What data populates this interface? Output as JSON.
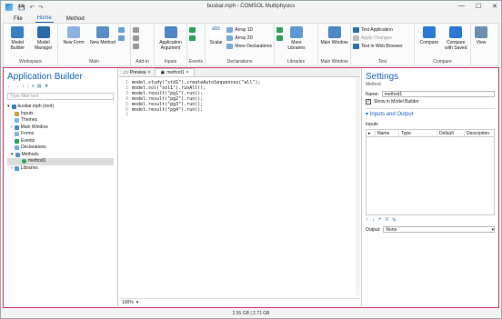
{
  "window": {
    "title": "busbar.mph - COMSOL Multiphysics",
    "minimize": "—",
    "maximize": "☐",
    "close": "✕"
  },
  "quick_access": [
    "▾",
    "↶",
    "▾",
    "↷",
    "▾"
  ],
  "menu": [
    {
      "label": "File"
    },
    {
      "label": "Home"
    },
    {
      "label": "Method"
    }
  ],
  "ribbon": {
    "workspace": {
      "label": "Workspace",
      "model_builder": "Model Builder",
      "model_manager": "Model Manager"
    },
    "main": {
      "label": "Main",
      "new_form": "New Form",
      "new_method": "New Method"
    },
    "addin": {
      "label": "Add-in"
    },
    "inputs": {
      "label": "Inputs",
      "app_argument": "Application Argument"
    },
    "events": {
      "label": "Events"
    },
    "declarations": {
      "label": "Declarations",
      "scalar": "Scalar",
      "array1d": "Array 1D",
      "array2d": "Array 2D",
      "more_decl": "More Declarations"
    },
    "libraries": {
      "label": "Libraries",
      "more_libraries": "More Libraries"
    },
    "main_window": {
      "label": "Main Window",
      "main_window": "Main Window"
    },
    "test": {
      "label": "Test",
      "test_app": "Test Application",
      "apply_changes": "Apply Changes",
      "test_browser": "Test in Web Browser"
    },
    "compare": {
      "label": "Compare",
      "compare": "Compare",
      "compare_saved": "Compare with Saved"
    },
    "layout": {
      "view": "View"
    }
  },
  "app_builder": {
    "title": "Application Builder",
    "filter_placeholder": "Type filter text",
    "tree": [
      {
        "label": "busbar.mph (root)",
        "level": 0
      },
      {
        "label": "Inputs",
        "level": 1
      },
      {
        "label": "Themes",
        "level": 1
      },
      {
        "label": "Main Window",
        "level": 1
      },
      {
        "label": "Forms",
        "level": 1
      },
      {
        "label": "Events",
        "level": 1
      },
      {
        "label": "Declarations",
        "level": 1
      },
      {
        "label": "Methods",
        "level": 1
      },
      {
        "label": "method1",
        "level": 2
      },
      {
        "label": "Libraries",
        "level": 1
      }
    ]
  },
  "editor": {
    "tabs": [
      {
        "label": "Preview"
      },
      {
        "label": "method1"
      }
    ],
    "lines": [
      {
        "n": "1",
        "text": "model.study(\"std1\").createAutoSequences(\"all\");"
      },
      {
        "n": "2",
        "text": "model.sol(\"sol1\").runAll();"
      },
      {
        "n": "3",
        "text": "model.result(\"pg1\").run();"
      },
      {
        "n": "4",
        "text": "model.result(\"pg2\").run();"
      },
      {
        "n": "5",
        "text": "model.result(\"pg3\").run();"
      },
      {
        "n": "6",
        "text": "model.result(\"pg4\").run();"
      },
      {
        "n": "7",
        "text": ""
      }
    ],
    "zoom": "100%"
  },
  "settings": {
    "title": "Settings",
    "subtitle": "Method",
    "name_label": "Name:",
    "name_value": "method1",
    "show_label": "Show in Model Builder",
    "section": "Inputs and Output",
    "inputs_label": "Inputs",
    "columns": [
      "Name",
      "Type",
      "Default",
      "Description"
    ],
    "output_label": "Output:",
    "output_value": "None"
  },
  "status": {
    "memory": "2.55 GB | 2.71 GB"
  }
}
